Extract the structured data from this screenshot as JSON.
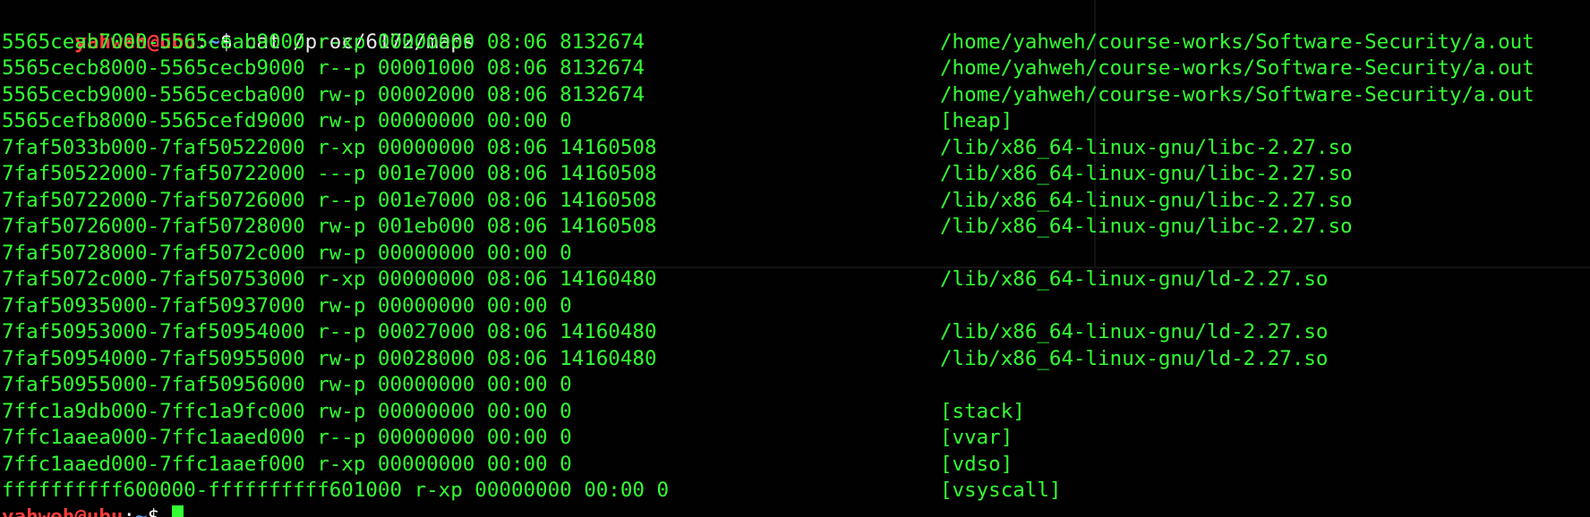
{
  "prompt": {
    "user": "yahweh@ubu",
    "sep": ":",
    "path": "~",
    "sign": "$",
    "command": "cat /proc/6172/maps"
  },
  "rows": [
    {
      "left": "5565ceab7000-5565ceab9000 r-xp 00000000 08:06 8132674",
      "right": "/home/yahweh/course-works/Software-Security/a.out"
    },
    {
      "left": "5565cecb8000-5565cecb9000 r--p 00001000 08:06 8132674",
      "right": "/home/yahweh/course-works/Software-Security/a.out"
    },
    {
      "left": "5565cecb9000-5565cecba000 rw-p 00002000 08:06 8132674",
      "right": "/home/yahweh/course-works/Software-Security/a.out"
    },
    {
      "left": "5565cefb8000-5565cefd9000 rw-p 00000000 00:00 0",
      "right": "[heap]"
    },
    {
      "left": "7faf5033b000-7faf50522000 r-xp 00000000 08:06 14160508",
      "right": "/lib/x86_64-linux-gnu/libc-2.27.so"
    },
    {
      "left": "7faf50522000-7faf50722000 ---p 001e7000 08:06 14160508",
      "right": "/lib/x86_64-linux-gnu/libc-2.27.so"
    },
    {
      "left": "7faf50722000-7faf50726000 r--p 001e7000 08:06 14160508",
      "right": "/lib/x86_64-linux-gnu/libc-2.27.so"
    },
    {
      "left": "7faf50726000-7faf50728000 rw-p 001eb000 08:06 14160508",
      "right": "/lib/x86_64-linux-gnu/libc-2.27.so"
    },
    {
      "left": "7faf50728000-7faf5072c000 rw-p 00000000 00:00 0",
      "right": ""
    },
    {
      "left": "7faf5072c000-7faf50753000 r-xp 00000000 08:06 14160480",
      "right": "/lib/x86_64-linux-gnu/ld-2.27.so"
    },
    {
      "left": "7faf50935000-7faf50937000 rw-p 00000000 00:00 0",
      "right": ""
    },
    {
      "left": "7faf50953000-7faf50954000 r--p 00027000 08:06 14160480",
      "right": "/lib/x86_64-linux-gnu/ld-2.27.so"
    },
    {
      "left": "7faf50954000-7faf50955000 rw-p 00028000 08:06 14160480",
      "right": "/lib/x86_64-linux-gnu/ld-2.27.so"
    },
    {
      "left": "7faf50955000-7faf50956000 rw-p 00000000 00:00 0",
      "right": ""
    },
    {
      "left": "7ffc1a9db000-7ffc1a9fc000 rw-p 00000000 00:00 0",
      "right": "[stack]"
    },
    {
      "left": "7ffc1aaea000-7ffc1aaed000 r--p 00000000 00:00 0",
      "right": "[vvar]"
    },
    {
      "left": "7ffc1aaed000-7ffc1aaef000 r-xp 00000000 00:00 0",
      "right": "[vdso]"
    },
    {
      "left": "ffffffffff600000-ffffffffff601000 r-xp 00000000 00:00 0",
      "right": "[vsyscall]"
    }
  ],
  "colors": {
    "output": "#33ff33",
    "user": "#ff3c3c",
    "path": "#5aa0ff",
    "background": "#010101"
  }
}
